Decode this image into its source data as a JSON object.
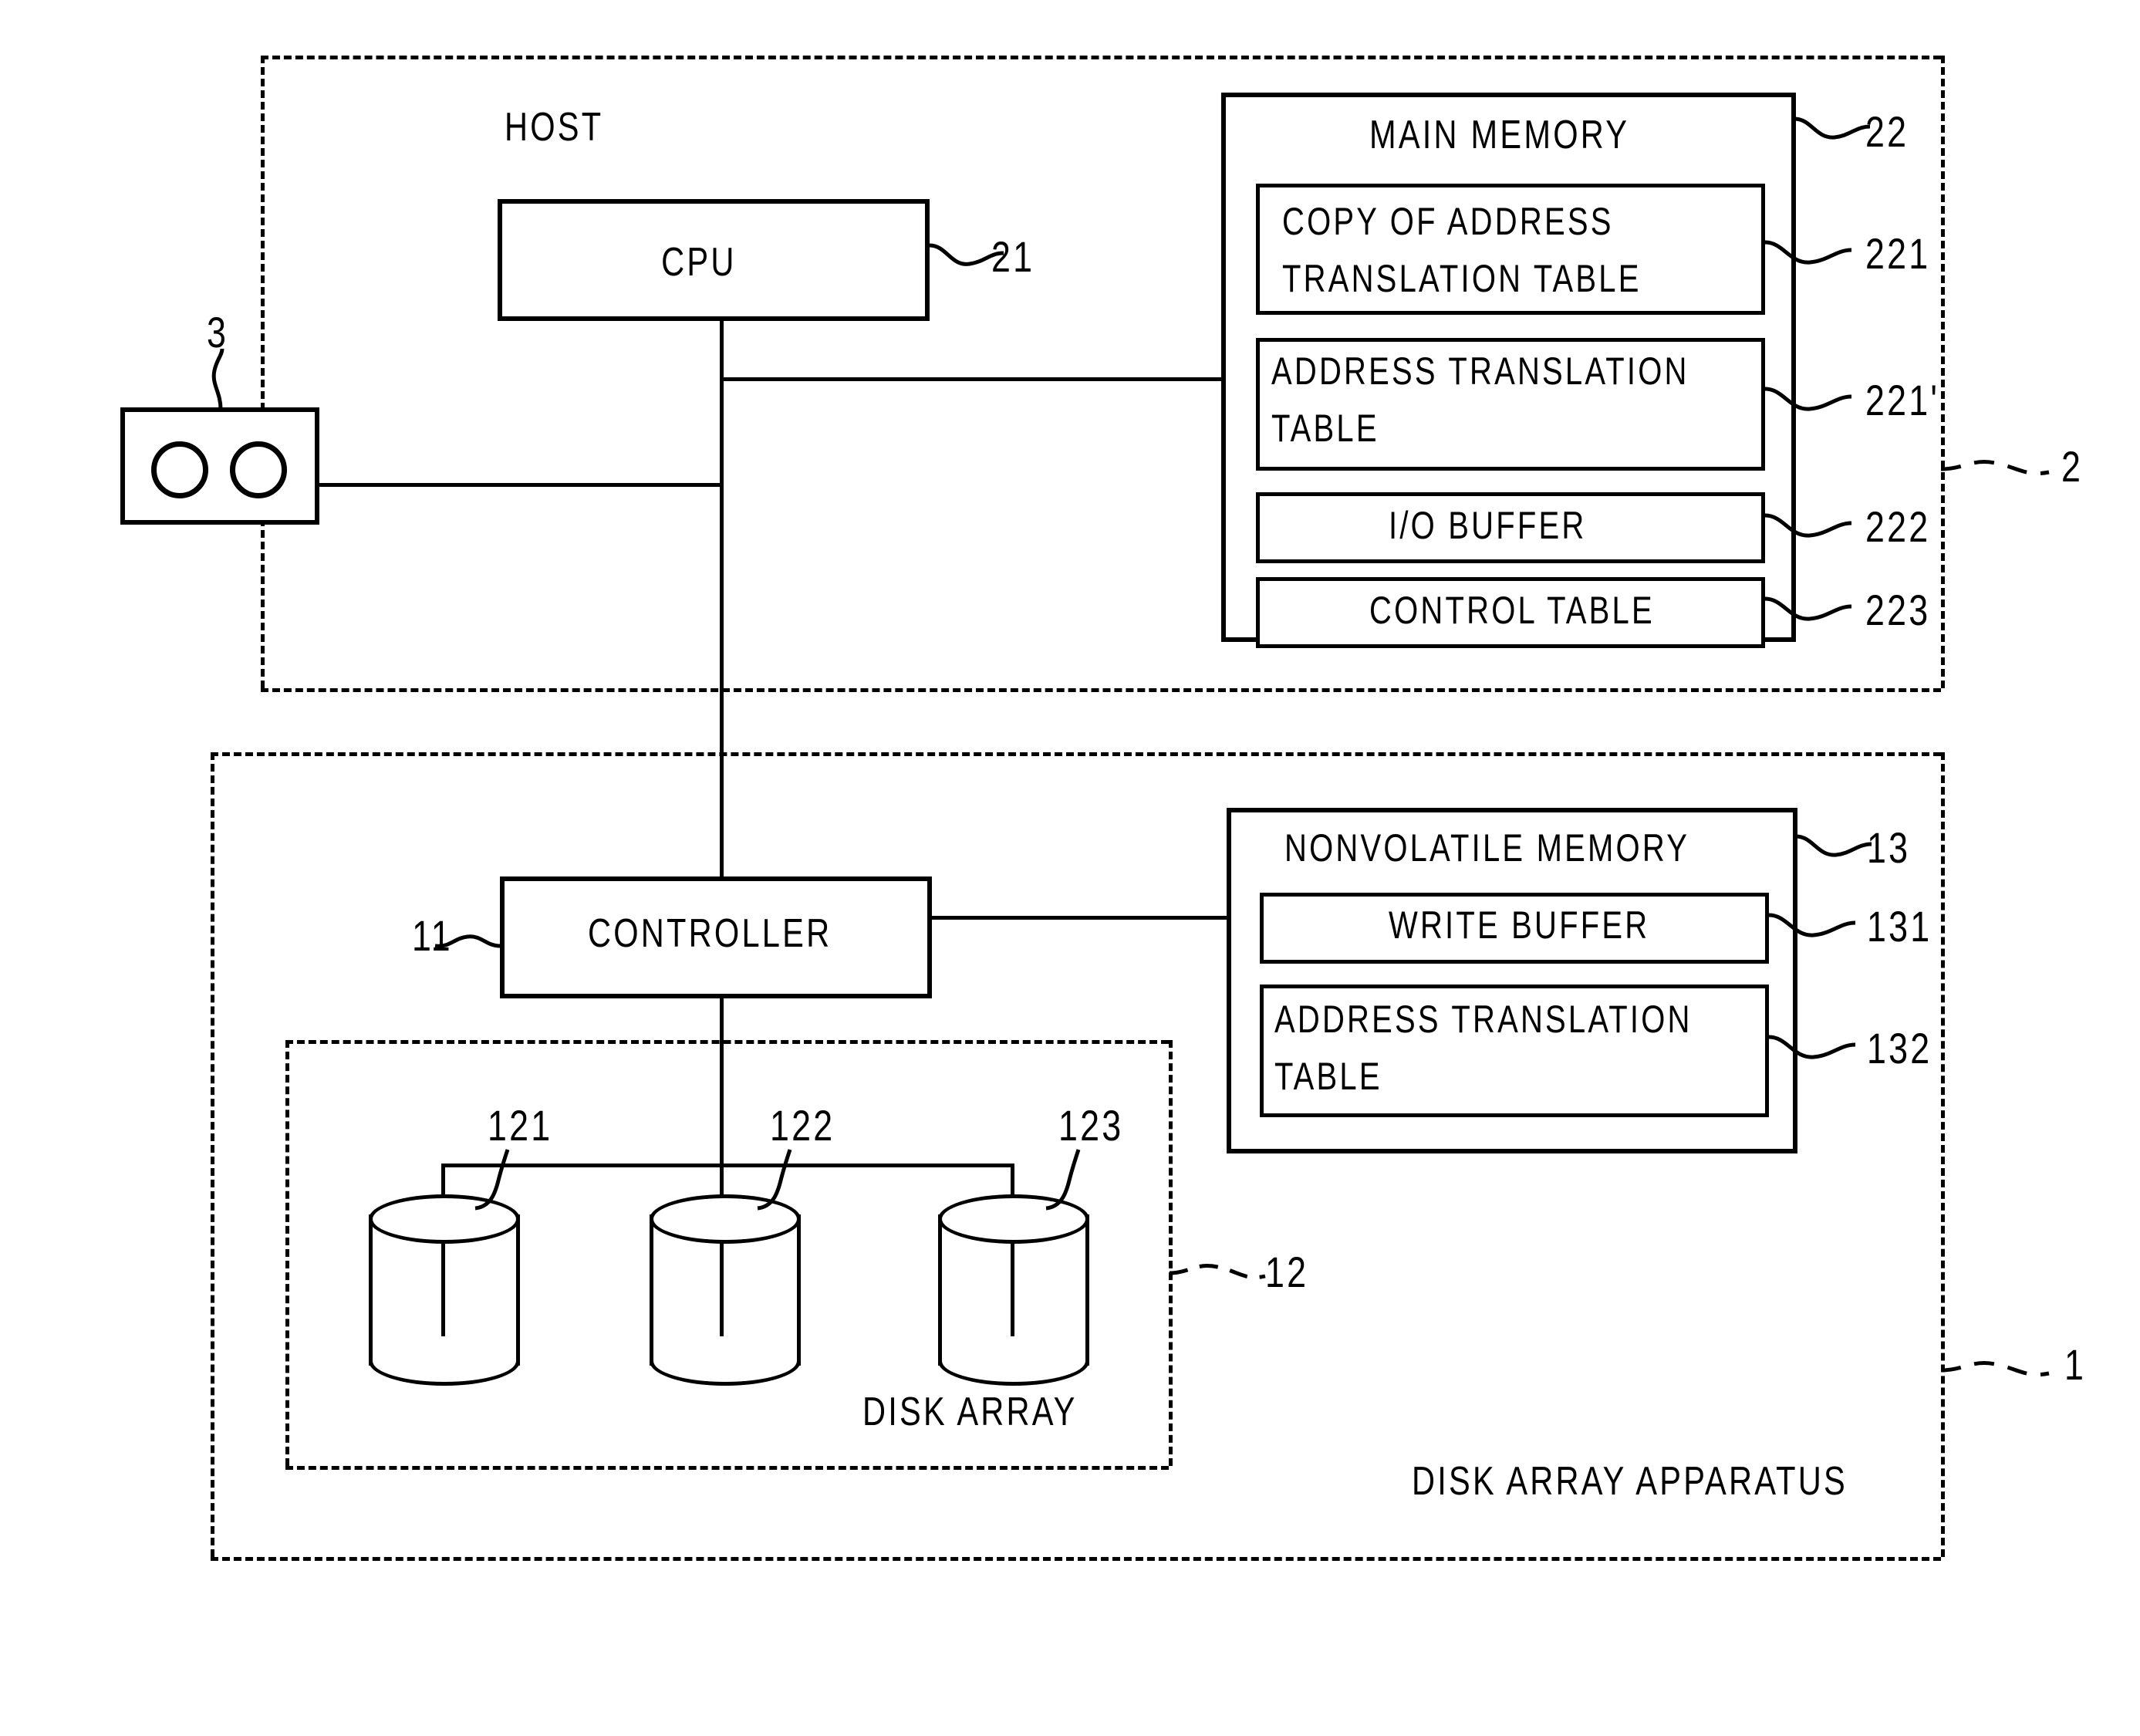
{
  "figure": {
    "host": {
      "label": "HOST",
      "ref": "2",
      "cpu": {
        "label": "CPU",
        "ref": "21"
      },
      "main_memory": {
        "label": "MAIN MEMORY",
        "ref": "22",
        "sections": [
          {
            "label": "COPY OF ADDRESS\nTRANSLATION TABLE",
            "line1": "COPY OF ADDRESS",
            "line2": "TRANSLATION TABLE",
            "ref": "221"
          },
          {
            "label": "ADDRESS TRANSLATION\nTABLE",
            "line1": "ADDRESS TRANSLATION",
            "line2": "TABLE",
            "ref": "221'"
          },
          {
            "label": "I/O BUFFER",
            "line1": "I/O BUFFER",
            "line2": "",
            "ref": "222"
          },
          {
            "label": "CONTROL TABLE",
            "line1": "CONTROL TABLE",
            "line2": "",
            "ref": "223"
          }
        ]
      }
    },
    "terminal": {
      "ref": "3",
      "ports": 2
    },
    "disk_array_apparatus": {
      "label": "DISK ARRAY APPARATUS",
      "ref": "1",
      "controller": {
        "label": "CONTROLLER",
        "ref": "11"
      },
      "nonvolatile_memory": {
        "label": "NONVOLATILE MEMORY",
        "ref": "13",
        "sections": [
          {
            "line1": "WRITE BUFFER",
            "line2": "",
            "ref": "131"
          },
          {
            "line1": "ADDRESS TRANSLATION",
            "line2": "TABLE",
            "ref": "132"
          }
        ]
      },
      "disk_array": {
        "label": "DISK ARRAY",
        "ref": "12",
        "disks": [
          {
            "ref": "121"
          },
          {
            "ref": "122"
          },
          {
            "ref": "123"
          }
        ]
      }
    },
    "colors": {
      "ink": "#000000",
      "paper": "#ffffff"
    }
  }
}
